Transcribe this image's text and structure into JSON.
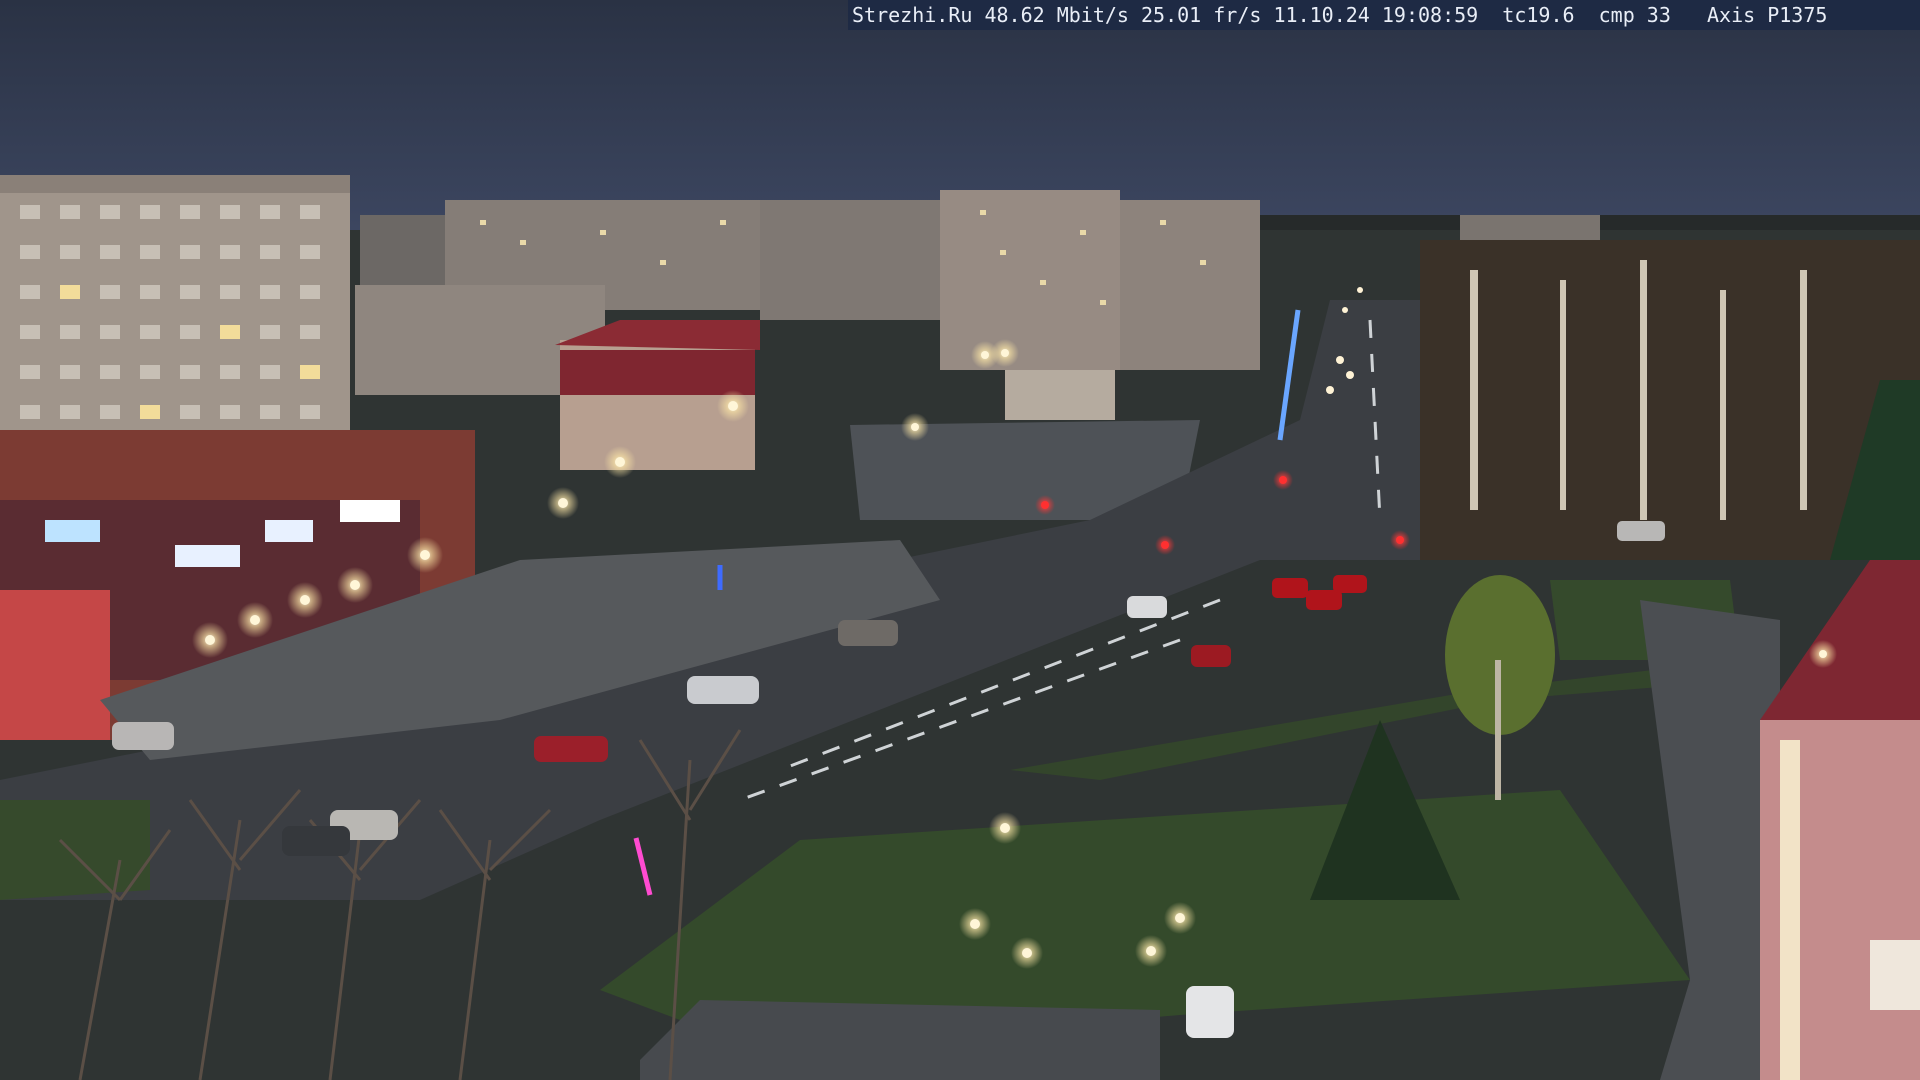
{
  "overlay": {
    "site": "Strezhi.Ru",
    "bitrate": "48.62 Mbit/s",
    "framerate": "25.01 fr/s",
    "date": "11.10.24",
    "time": "19:08:59",
    "tc": "tc19.6",
    "cmp": "cmp 33",
    "camera": "Axis P1375"
  },
  "scene": {
    "description_icons": [
      "street-lamp-icon",
      "car-icon",
      "tree-icon",
      "building-icon"
    ],
    "colors": {
      "sky": "#2b3447",
      "road": "#3c3f45",
      "grass": "#394a2a",
      "building": "#9b8f86",
      "lamp": "#fff6d8",
      "tail_light": "#ff2a2a"
    }
  }
}
